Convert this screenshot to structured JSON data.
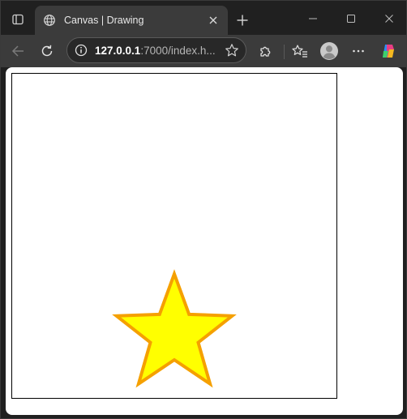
{
  "browser": {
    "tab": {
      "title": "Canvas | Drawing"
    },
    "address_bar": {
      "host": "127.0.0.1",
      "rest": ":7000/index.h..."
    }
  },
  "canvas": {
    "star": {
      "fill_color": "#ffff00",
      "stroke_color": "#f5a000",
      "points": 5
    }
  },
  "colors": {
    "chrome_dark": "#202020",
    "toolbar": "#3b3b3b",
    "page_bg": "#ffffff"
  }
}
